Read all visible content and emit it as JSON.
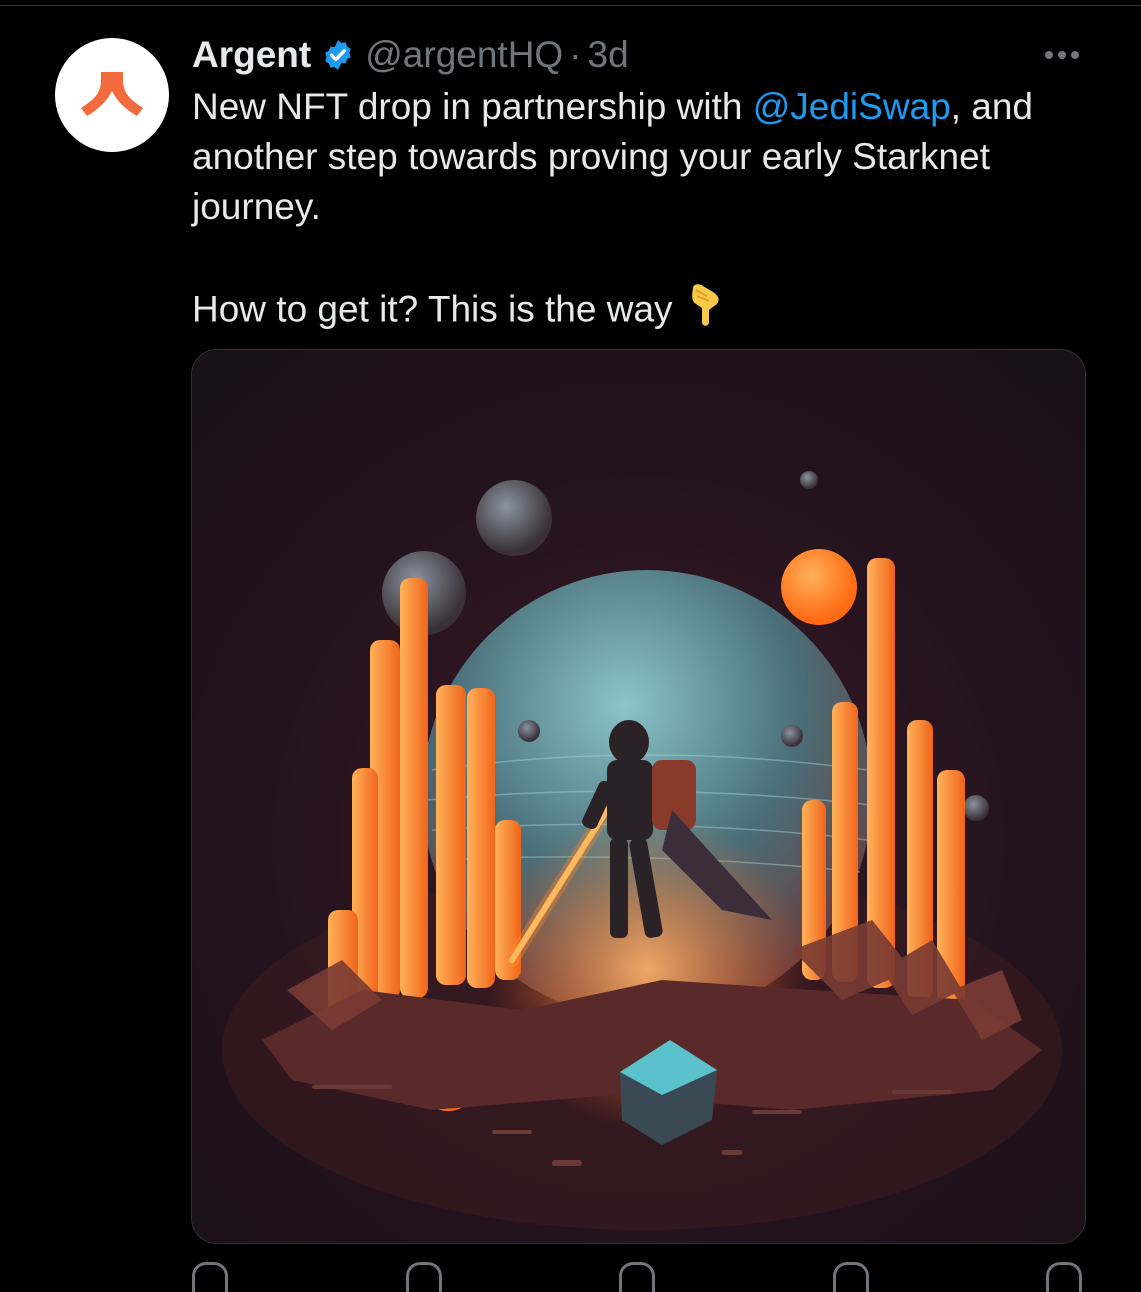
{
  "tweet": {
    "author_name": "Argent",
    "handle": "@argentHQ",
    "separator": "·",
    "time": "3d",
    "text_line1_pre": "New NFT drop in partnership with ",
    "mention": "@JediSwap",
    "text_line1_post": ", and",
    "text_line2": "another step towards proving your early Starknet",
    "text_line3": "journey.",
    "text_line5": "How to get it? This is the way",
    "emoji": "pointing-down-hand"
  },
  "icons": {
    "avatar": "argent-logo-icon",
    "verified": "verified-badge-icon",
    "more": "more-options-icon",
    "reply": "reply-icon",
    "retweet": "retweet-icon",
    "like": "like-icon",
    "views": "views-icon",
    "share": "share-icon"
  },
  "colors": {
    "background": "#000000",
    "text": "#e7e9ea",
    "secondary": "#71767b",
    "accent": "#1d9bf0",
    "argent_orange": "#f36a3d"
  }
}
